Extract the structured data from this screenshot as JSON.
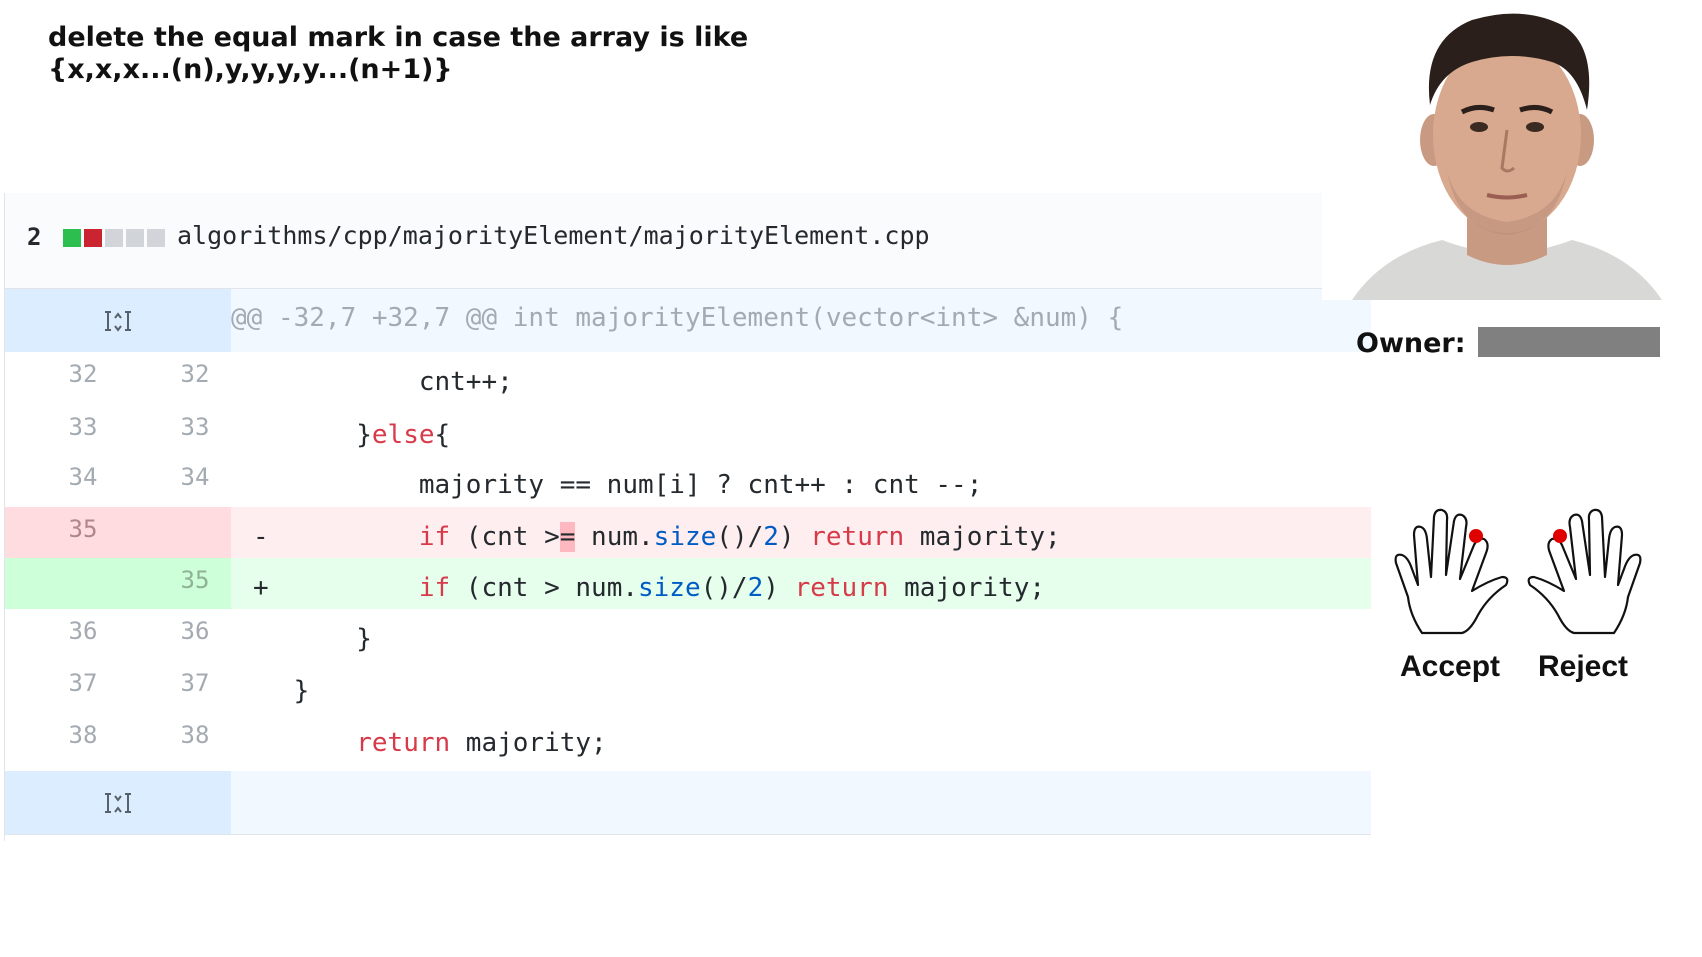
{
  "caption": {
    "line1": "delete the equal mark in case the array is like",
    "line2": "{x,x,x...(n),y,y,y,y...(n+1)}"
  },
  "file": {
    "change_count": "2",
    "path": "algorithms/cpp/majorityElement/majorityElement.cpp",
    "diffstat_colors": [
      "#2cbe4e",
      "#cb2431",
      "#d1d5da",
      "#d1d5da",
      "#d1d5da"
    ]
  },
  "hunk_header": "@@ -32,7 +32,7 @@ int majorityElement(vector<int> &num) {",
  "lines": [
    {
      "old": "32",
      "new": "32",
      "type": "context",
      "text": "            cnt++;"
    },
    {
      "old": "33",
      "new": "33",
      "type": "context",
      "text_pre": "        }",
      "kw": "else",
      "text_post": "{"
    },
    {
      "old": "34",
      "new": "34",
      "type": "context",
      "text": "            majority == num[i] ? cnt++ : cnt --;"
    },
    {
      "old": "35",
      "new": "",
      "type": "deletion",
      "sign": "-"
    },
    {
      "old": "",
      "new": "35",
      "type": "addition",
      "sign": "+"
    },
    {
      "old": "36",
      "new": "36",
      "type": "context",
      "text": "        }"
    },
    {
      "old": "37",
      "new": "37",
      "type": "context",
      "text": "    }"
    },
    {
      "old": "38",
      "new": "38",
      "type": "context",
      "kw": "return",
      "text_post": " majority;"
    }
  ],
  "deleted_line": {
    "indent": "            ",
    "kw_if": "if",
    "pre": " (cnt >",
    "highlight": "=",
    "mid": " num.",
    "fn": "size",
    "post1": "()/",
    "num": "2",
    "post2": ") ",
    "kw_return": "return",
    "end": " majority;"
  },
  "added_line": {
    "indent": "            ",
    "kw_if": "if",
    "pre": " (cnt > num.",
    "fn": "size",
    "post1": "()/",
    "num": "2",
    "post2": ") ",
    "kw_return": "return",
    "end": " majority;"
  },
  "owner": {
    "label": "Owner:",
    "value_redacted": true
  },
  "choices": {
    "accept": "Accept",
    "reject": "Reject"
  },
  "icons": {
    "expand_up": "expand-up-icon",
    "expand_down": "expand-down-icon",
    "left_hand": "left-hand-icon",
    "right_hand": "right-hand-icon"
  },
  "colors": {
    "deletion_bg": "#ffeef0",
    "addition_bg": "#e6ffed",
    "hunk_bg": "#f1f8ff",
    "keyword": "#d73a49",
    "function": "#005cc5",
    "finger_dot": "#e00000"
  }
}
